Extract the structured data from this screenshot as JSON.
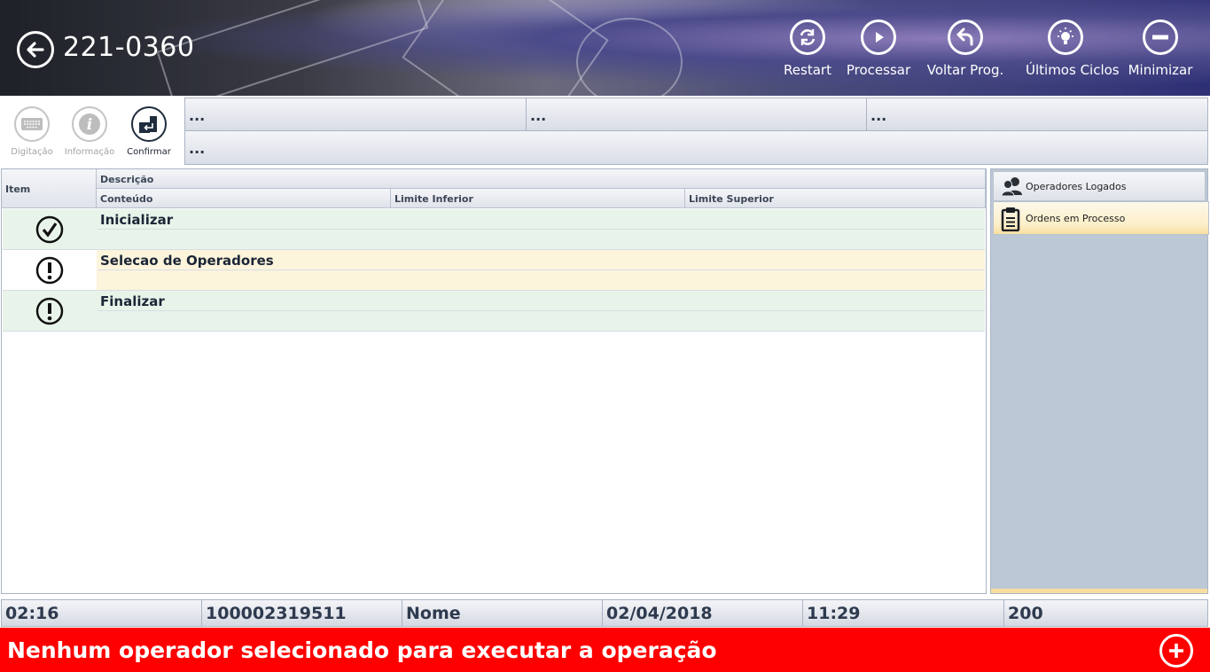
{
  "header": {
    "title": "221-0360",
    "actions": [
      {
        "label": "Restart",
        "icon": "restart-icon"
      },
      {
        "label": "Processar",
        "icon": "play-icon"
      },
      {
        "label": "Voltar Prog.",
        "icon": "undo-icon"
      },
      {
        "label": "Últimos Ciclos",
        "icon": "lightbulb-icon"
      },
      {
        "label": "Minimizar",
        "icon": "minus-icon"
      }
    ]
  },
  "subtoolbar": {
    "buttons": [
      {
        "label": "Digitação",
        "icon": "keyboard-icon",
        "enabled": false
      },
      {
        "label": "Informação",
        "icon": "info-icon",
        "enabled": false
      },
      {
        "label": "Confirmar",
        "icon": "enter-icon",
        "enabled": true
      }
    ],
    "fields": [
      "...",
      "...",
      "...",
      "..."
    ]
  },
  "grid": {
    "headers": {
      "item": "Item",
      "descricao": "Descrição",
      "conteudo": "Conteúdo",
      "limite_inferior": "Limite Inferior",
      "limite_superior": "Limite Superior"
    },
    "rows": [
      {
        "description": "Inicializar",
        "status": "check",
        "color": "#e8f4ea"
      },
      {
        "description": "Selecao de Operadores",
        "status": "warning",
        "color": "#fdf4dc"
      },
      {
        "description": "Finalizar",
        "status": "warning",
        "color": "#e8f4ea"
      }
    ]
  },
  "side_panel": {
    "tabs": [
      {
        "label": "Operadores Logados",
        "icon": "users-icon"
      },
      {
        "label": "Ordens em Processo",
        "icon": "clipboard-icon",
        "active": true
      }
    ]
  },
  "status_bar": [
    "02:16",
    "100002319511",
    "Nome",
    "02/04/2018",
    "11:29",
    "200"
  ],
  "message": {
    "text": "Nenhum operador selecionado para executar a operação",
    "color": "#ff0000",
    "action_icon": "plus-icon"
  }
}
